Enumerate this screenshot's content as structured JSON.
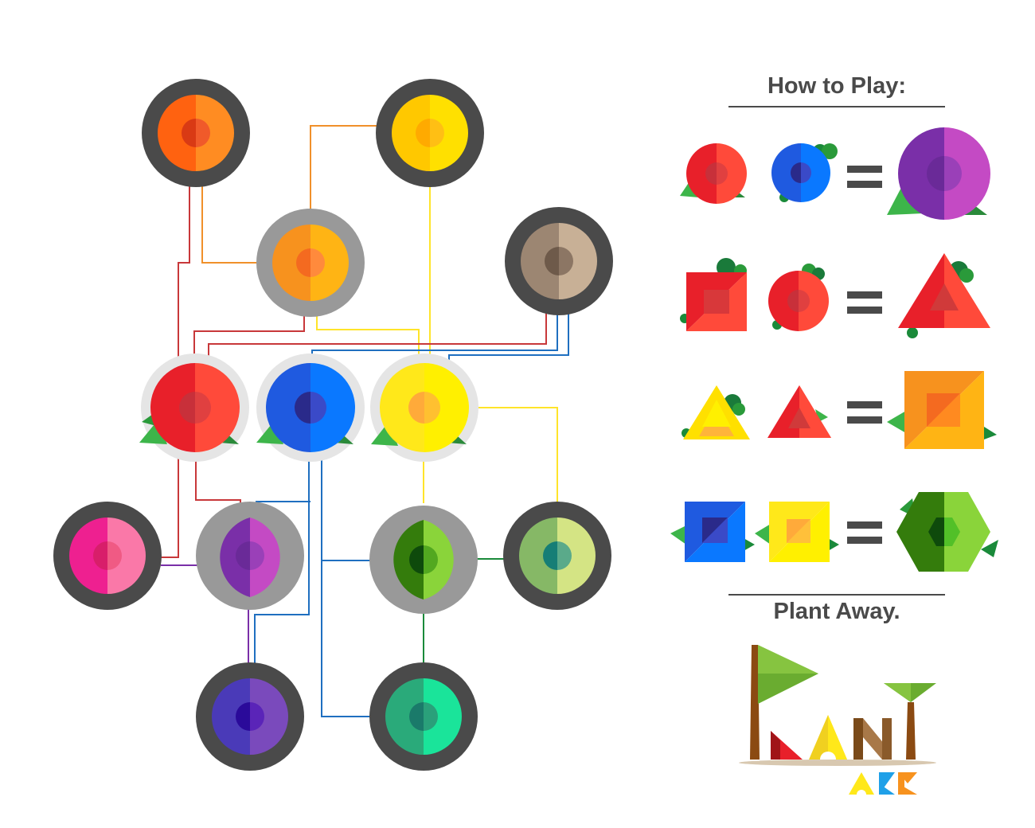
{
  "how_to_play": {
    "title": "How to Play:"
  },
  "tagline": "Plant Away.",
  "logo": {
    "word": "PLANT",
    "sub": "AGE",
    "style": "geometric-logo-picture"
  },
  "board": {
    "seed_types": [
      "red-circle",
      "blue-circle",
      "yellow-circle"
    ],
    "node_colors": [
      "orange",
      "gold",
      "amber",
      "tan",
      "red",
      "blue",
      "yellow",
      "pink",
      "purple",
      "green",
      "lime",
      "indigo",
      "teal"
    ]
  },
  "colors": {
    "ring_dark": "#4a4a4a",
    "ring_mid": "#999999",
    "ring_light": "#e5e5e5",
    "red": "#e8202a",
    "blue": "#1f5ae0",
    "yellow": "#ffe81a",
    "orange": "#ff6a10",
    "purple": "#8a2fa8",
    "green": "#3a7d12",
    "leaf": "#3db54a"
  },
  "recipes": [
    {
      "a": "red-circle",
      "b": "blue-circle",
      "result": "purple-circle"
    },
    {
      "a": "red-square",
      "b": "red-circle",
      "result": "red-triangle"
    },
    {
      "a": "yellow-triangle",
      "b": "red-triangle",
      "result": "orange-square"
    },
    {
      "a": "blue-square",
      "b": "yellow-square",
      "result": "green-hexagon"
    }
  ]
}
